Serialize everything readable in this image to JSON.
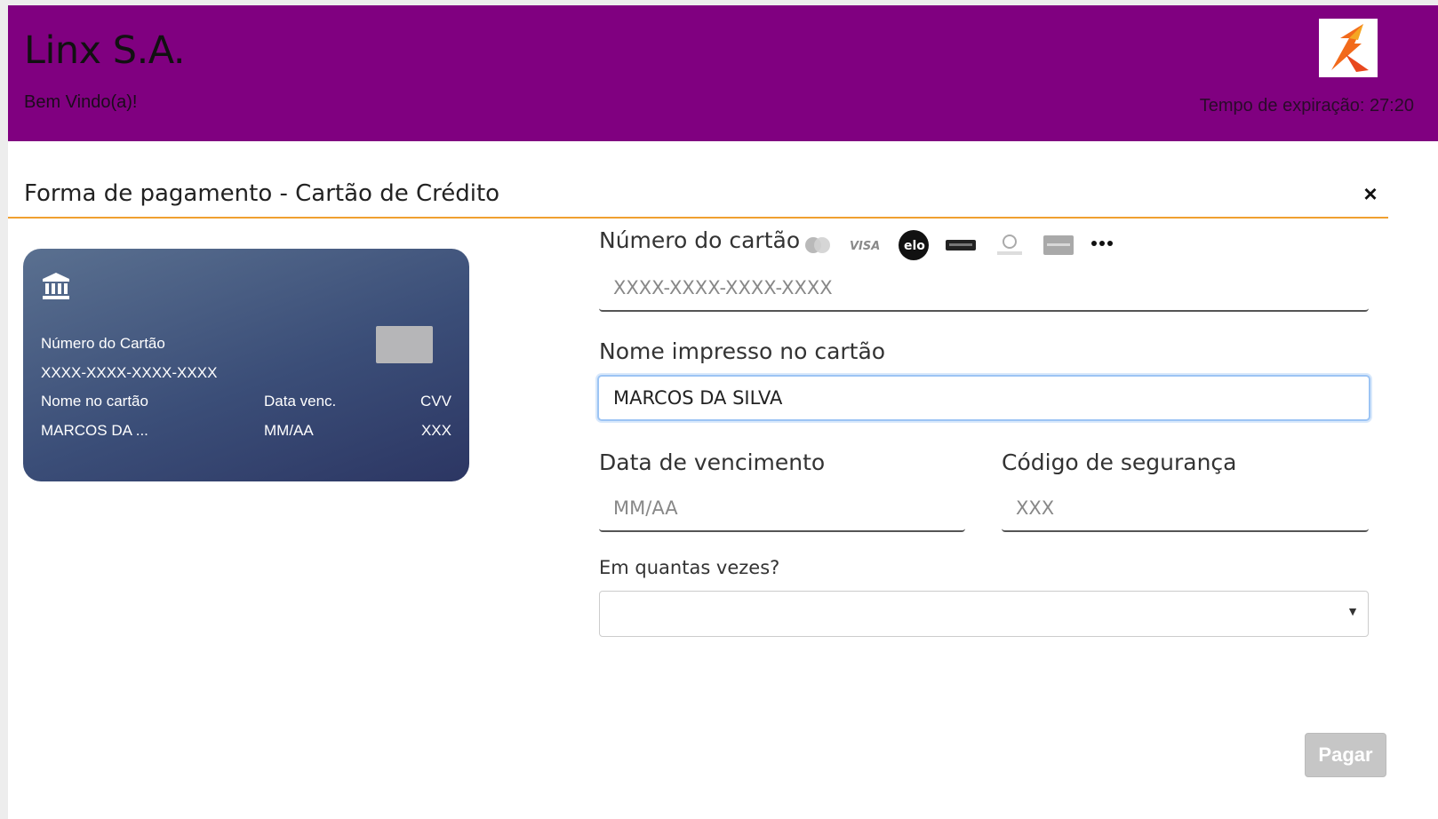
{
  "header": {
    "company": "Linx S.A.",
    "welcome": "Bem Vindo(a)!",
    "expiry_label": "Tempo de expiração: 27:20",
    "background_color": "#800080",
    "logo_icon": "linx-logo-icon"
  },
  "section": {
    "title": "Forma de pagamento - Cartão de Crédito",
    "close_label": "×",
    "accent_color": "#f0a030"
  },
  "card_preview": {
    "bank_icon": "bank-icon",
    "number_label": "Número do Cartão",
    "number_value": "XXXX-XXXX-XXXX-XXXX",
    "name_label": "Nome no cartão",
    "name_value": "MARCOS DA ...",
    "exp_label": "Data venc.",
    "exp_value": "MM/AA",
    "cvv_label": "CVV",
    "cvv_value": "XXX"
  },
  "form": {
    "card_number": {
      "label": "Número do cartão",
      "placeholder": "XXXX-XXXX-XXXX-XXXX",
      "value": "",
      "brand_icons": [
        "mastercard-icon",
        "visa-icon",
        "elo-icon",
        "hipercard-icon",
        "diners-icon",
        "amex-icon",
        "more-icon"
      ]
    },
    "card_name": {
      "label": "Nome impresso no cartão",
      "placeholder": "",
      "value": "MARCOS DA SILVA"
    },
    "expiration": {
      "label": "Data de vencimento",
      "placeholder": "MM/AA",
      "value": ""
    },
    "security_code": {
      "label": "Código de segurança",
      "placeholder": "XXX",
      "value": ""
    },
    "installments": {
      "label": "Em quantas vezes?",
      "selected": ""
    }
  },
  "actions": {
    "pay_label": "Pagar"
  }
}
